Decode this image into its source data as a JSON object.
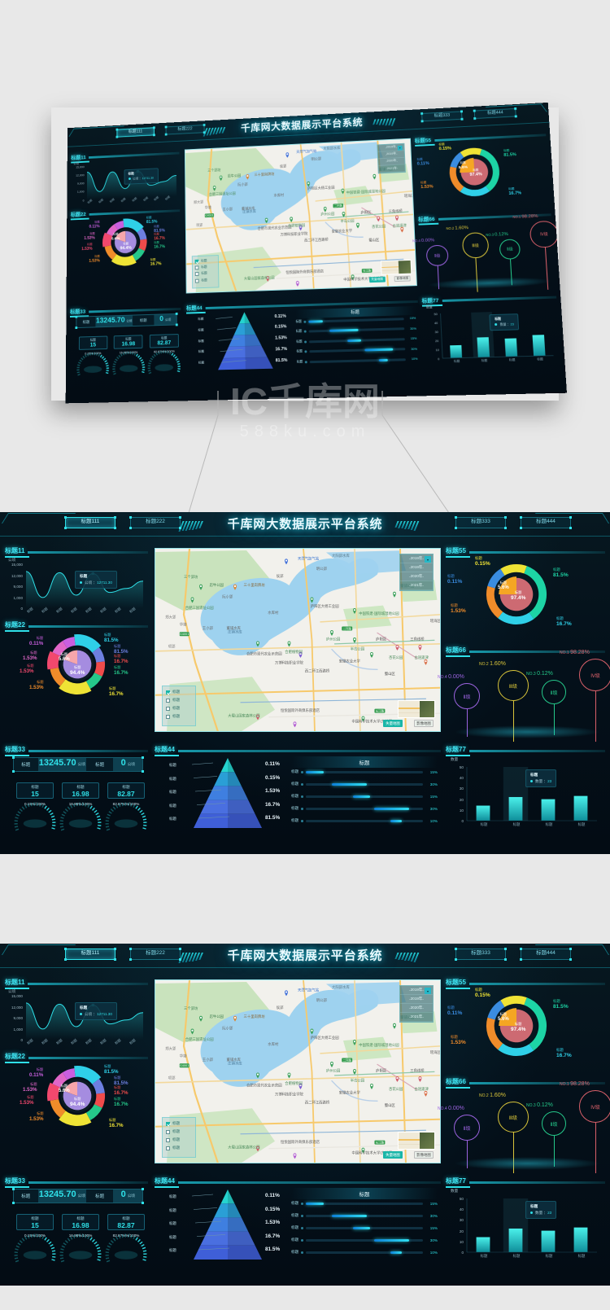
{
  "app": {
    "title": "千库网大数据展示平台系统",
    "tabs": [
      {
        "label": "标题111",
        "active": true
      },
      {
        "label": "标题222",
        "active": false
      },
      {
        "label": "标题333",
        "active": false
      },
      {
        "label": "标题444",
        "active": false
      }
    ]
  },
  "panels": {
    "p11": "标题11",
    "p22": "标题22",
    "p33": "标题33",
    "p44": "标题44",
    "p55": "标题55",
    "p66": "标题66",
    "p77": "标题77"
  },
  "watermark": {
    "main": "千库网",
    "sub": "588ku.com",
    "mark": "IC"
  },
  "chart_data": [
    {
      "type": "line",
      "id": "line-11",
      "title": "标题11",
      "ylabel": "公顷",
      "xlabel": "",
      "ylim": [
        0,
        15000
      ],
      "yticks": [
        "0",
        "1,000",
        "9,000",
        "12,000",
        "15,000"
      ],
      "categories": [
        "标题",
        "标题",
        "标题",
        "标题",
        "标题",
        "标题",
        "标题",
        "标题"
      ],
      "values": [
        12100,
        3500,
        11700,
        4300,
        11400,
        5200,
        6500,
        8900
      ],
      "grid": false,
      "legend": "none",
      "tooltip": {
        "title": "标题",
        "series": "公顷",
        "value": "12711.30"
      }
    },
    {
      "type": "pie",
      "id": "donut-22",
      "title": "标题22",
      "inner_slices": [
        {
          "label": "标题",
          "value": "5.6%",
          "color": "#f6a6ab"
        },
        {
          "label": "标题",
          "value": "94.4%",
          "color": "#a58ce0"
        }
      ],
      "outer_slices": [
        {
          "label": "标题",
          "value": "81.5%",
          "color": "#2fd0e8"
        },
        {
          "label": "标题",
          "value": "81.5%",
          "color": "#6d7fe0"
        },
        {
          "label": "标题",
          "value": "16.7%",
          "color": "#ef4b4b"
        },
        {
          "label": "标题",
          "value": "16.7%",
          "color": "#25c88a"
        },
        {
          "label": "标题",
          "value": "16.7%",
          "color": "#efe335"
        },
        {
          "label": "标题",
          "value": "1.53%",
          "color": "#f08c2a"
        },
        {
          "label": "标题",
          "value": "1.53%",
          "color": "#f2486d"
        },
        {
          "label": "标题",
          "value": "1.53%",
          "color": "#e066c8"
        },
        {
          "label": "标题",
          "value": "0.11%",
          "color": "#c95fe0"
        }
      ]
    },
    {
      "type": "pie",
      "id": "donut-55",
      "title": "标题55",
      "inner_slices": [
        {
          "label": "标题",
          "value": "5.6%",
          "color": "#f5a623"
        },
        {
          "label": "标题",
          "value": "97.4%",
          "color": "#cd6a72"
        }
      ],
      "outer_slices": [
        {
          "label": "标题",
          "value": "81.5%",
          "color": "#1dd4a5"
        },
        {
          "label": "标题",
          "value": "16.7%",
          "color": "#2fd0e8"
        },
        {
          "label": "标题",
          "value": "1.53%",
          "color": "#f08c2a"
        },
        {
          "label": "标题",
          "value": "0.11%",
          "color": "#3a8ce0"
        },
        {
          "label": "标题",
          "value": "0.15%",
          "color": "#efe335"
        }
      ]
    },
    {
      "type": "bar",
      "id": "pyramid-44",
      "title": "标题44",
      "layers": [
        {
          "label": "标题",
          "value": "0.11%",
          "color": "#25d4cf"
        },
        {
          "label": "标题",
          "value": "0.15%",
          "color": "#2a9fd6"
        },
        {
          "label": "标题",
          "value": "1.53%",
          "color": "#3f7fe0"
        },
        {
          "label": "标题",
          "value": "16.7%",
          "color": "#4a6fe0"
        },
        {
          "label": "标题",
          "value": "81.5%",
          "color": "#3f5fd8"
        }
      ]
    },
    {
      "type": "bar",
      "id": "progress-44",
      "title": "标题",
      "orientation": "horizontal",
      "categories": [
        "标题",
        "标题",
        "标题",
        "标题",
        "标题"
      ],
      "values": [
        15,
        30,
        15,
        30,
        10
      ],
      "value_labels": [
        "15%",
        "30%",
        "15%",
        "30%",
        "10%"
      ],
      "offsets": [
        0,
        22,
        40,
        58,
        72
      ]
    },
    {
      "type": "bar",
      "id": "bar-77",
      "title": "标题77",
      "ylabel": "数量",
      "ylim": [
        0,
        50
      ],
      "yticks": [
        "0",
        "10",
        "20",
        "30",
        "40",
        "50"
      ],
      "categories": [
        "标题",
        "标题",
        "标题",
        "标题"
      ],
      "values": [
        14,
        22,
        20,
        23
      ],
      "grid": false,
      "tooltip": {
        "title": "标题",
        "series": "数量",
        "value": "23"
      }
    }
  ],
  "stats": {
    "row": [
      {
        "label": "标题",
        "value": "13245.70",
        "unit": "公顷"
      },
      {
        "label": "标题",
        "value": "0",
        "unit": "公顷"
      }
    ],
    "kpis": [
      {
        "label": "标题",
        "value": "15",
        "gauge": "0.15%/100%"
      },
      {
        "label": "标题",
        "value": "16.98",
        "gauge": "16.98%/100%"
      },
      {
        "label": "标题",
        "value": "82.87",
        "gauge": "82.87%%/100%"
      }
    ]
  },
  "grades": [
    {
      "rank": "NO.4",
      "pct": "0.00%",
      "level": "Ⅱ级",
      "color": "#9b63e0"
    },
    {
      "rank": "NO.2",
      "pct": "1.60%",
      "level": "Ⅲ级",
      "color": "#d8c43a"
    },
    {
      "rank": "NO.3",
      "pct": "0.12%",
      "level": "Ⅱ级",
      "color": "#25c88a"
    },
    {
      "rank": "NO.1",
      "pct": "98.28%",
      "level": "Ⅳ级",
      "color": "#d9606a"
    }
  ],
  "map": {
    "legend_items": [
      {
        "label": "标题",
        "checked": true
      },
      {
        "label": "标题",
        "checked": false
      },
      {
        "label": "标题",
        "checked": false
      },
      {
        "label": "标题",
        "checked": false
      }
    ],
    "year_selected": "2019年",
    "year_options": [
      "2019年",
      "2020年",
      "2021年"
    ],
    "buttons": [
      {
        "label": "失量地图"
      },
      {
        "label": "影像地图"
      }
    ],
    "labels": [
      "天然气加气站",
      "大阳郢水库",
      "三个郢坊",
      "忍牛公园",
      "三十里岗牌坊",
      "阮小郢",
      "侯郢",
      "明公郢",
      "合肥三国遗址公园",
      "水库村",
      "庄镇水库",
      "王小郢",
      "郑大郢",
      "华塘",
      "项郢",
      "庐阳区大杨工业园",
      "中国铁建·国际城湿地公园",
      "董铺水库",
      "合肥市现代农业示范园",
      "合肥植物园",
      "万博科技职业学院",
      "庐州公园",
      "半岛公园",
      "安徽农业大学",
      "庐阳区",
      "三角线桥",
      "杏花公园",
      "古逍遥津",
      "蜀山区",
      "西二环江西路桥",
      "大蜀山国家森林公园",
      "恒悦国际外商俱乐部酒店",
      "中国科学技术大学(东校区)",
      "瑶海区",
      "董铺公园",
      "翡翠湖"
    ]
  }
}
